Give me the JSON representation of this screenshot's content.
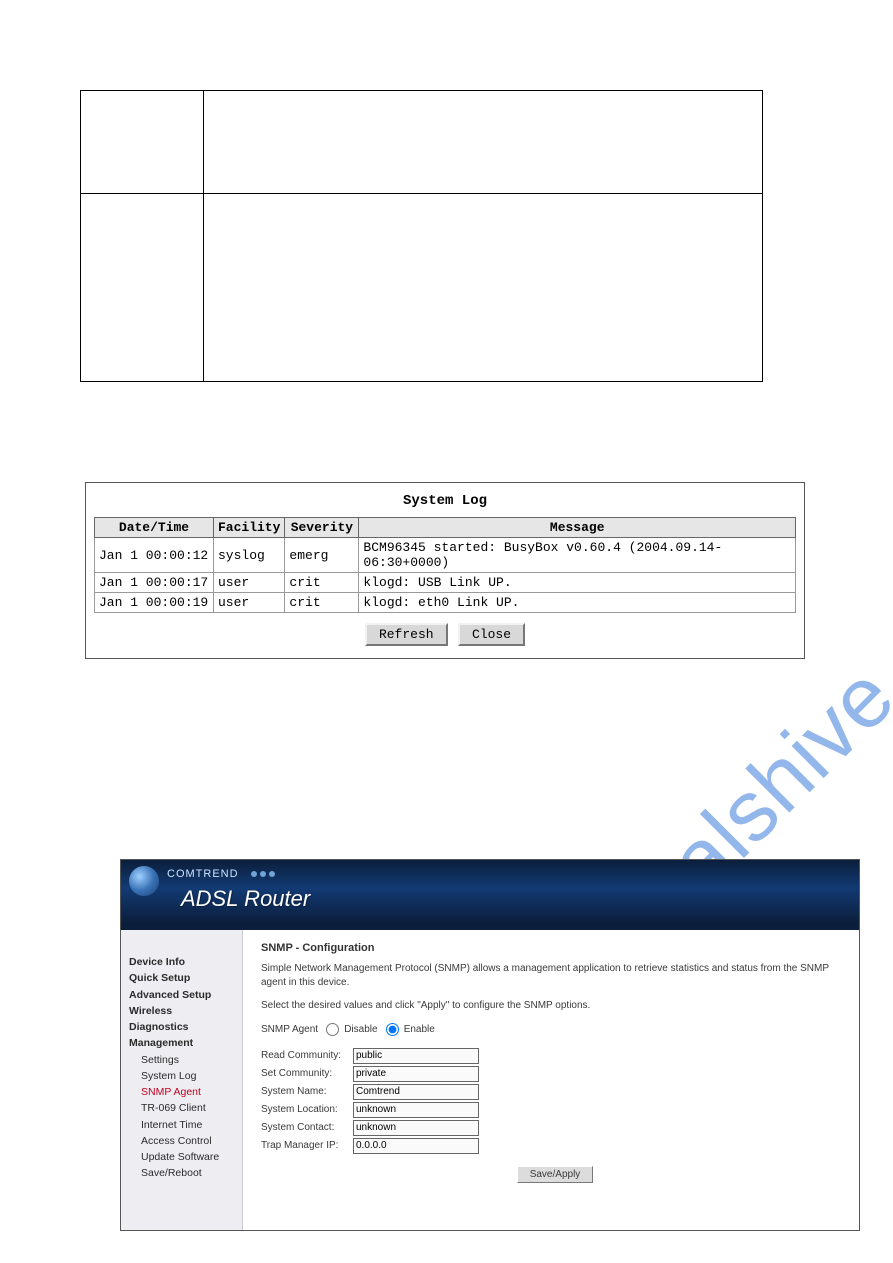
{
  "watermark": "manualshive.com",
  "top_table": {
    "rows": [
      {
        "left_width": 120,
        "height": 100,
        "col1": "",
        "col2": ""
      },
      {
        "left_width": 120,
        "height": 185,
        "col1": "",
        "col2": ""
      }
    ]
  },
  "syslog": {
    "title": "System Log",
    "columns": [
      "Date/Time",
      "Facility",
      "Severity",
      "Message"
    ],
    "rows": [
      {
        "dt": "Jan 1 00:00:12",
        "fac": "syslog",
        "sev": "emerg",
        "msg": "BCM96345 started: BusyBox v0.60.4 (2004.09.14-06:30+0000)"
      },
      {
        "dt": "Jan 1 00:00:17",
        "fac": "user",
        "sev": "crit",
        "msg": "klogd: USB Link UP."
      },
      {
        "dt": "Jan 1 00:00:19",
        "fac": "user",
        "sev": "crit",
        "msg": "klogd: eth0 Link UP."
      }
    ],
    "buttons": {
      "refresh": "Refresh",
      "close": "Close"
    }
  },
  "router": {
    "brand": "COMTREND",
    "product": "ADSL Router",
    "nav": {
      "top": [
        "Device Info",
        "Quick Setup",
        "Advanced Setup",
        "Wireless",
        "Diagnostics",
        "Management"
      ],
      "mgmt_sub": [
        "Settings",
        "System Log",
        "SNMP Agent",
        "TR-069 Client",
        "Internet Time",
        "Access Control",
        "Update Software",
        "Save/Reboot"
      ],
      "active": "SNMP Agent"
    },
    "content": {
      "title": "SNMP - Configuration",
      "desc1": "Simple Network Management Protocol (SNMP) allows a management application to retrieve statistics and status from the SNMP agent in this device.",
      "desc2": "Select the desired values and click \"Apply\" to configure the SNMP options.",
      "agent_label": "SNMP Agent",
      "disable_label": "Disable",
      "enable_label": "Enable",
      "agent_enabled": true,
      "fields": {
        "read_comm": {
          "label": "Read Community:",
          "value": "public"
        },
        "set_comm": {
          "label": "Set Community:",
          "value": "private"
        },
        "sys_name": {
          "label": "System Name:",
          "value": "Comtrend"
        },
        "sys_loc": {
          "label": "System Location:",
          "value": "unknown"
        },
        "sys_contact": {
          "label": "System Contact:",
          "value": "unknown"
        },
        "trap_ip": {
          "label": "Trap Manager IP:",
          "value": "0.0.0.0"
        }
      },
      "save_label": "Save/Apply"
    }
  }
}
